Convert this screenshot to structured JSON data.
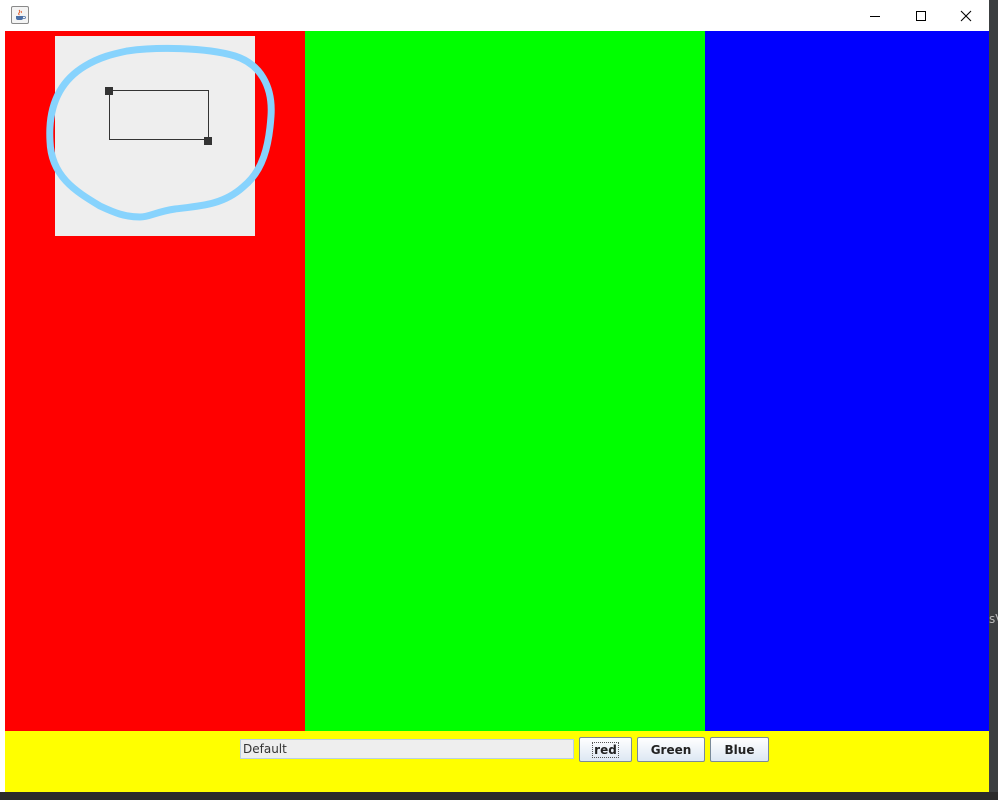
{
  "window": {
    "title": "",
    "icon": "java-cup-icon",
    "controls": {
      "minimize": "minimize-icon",
      "maximize": "maximize-icon",
      "close": "close-icon"
    }
  },
  "panels": {
    "left_color": "#ff0000",
    "center_color": "#00ff00",
    "right_color": "#0000ff",
    "bottom_color": "#ffff00"
  },
  "drawing": {
    "canvas_color": "#eeeeee",
    "highlight_color": "#87d3fd"
  },
  "toolbar": {
    "text_field_value": "Default",
    "red_label": "red",
    "green_label": "Green",
    "blue_label": "Blue"
  },
  "background": {
    "side_mark": "sV"
  }
}
